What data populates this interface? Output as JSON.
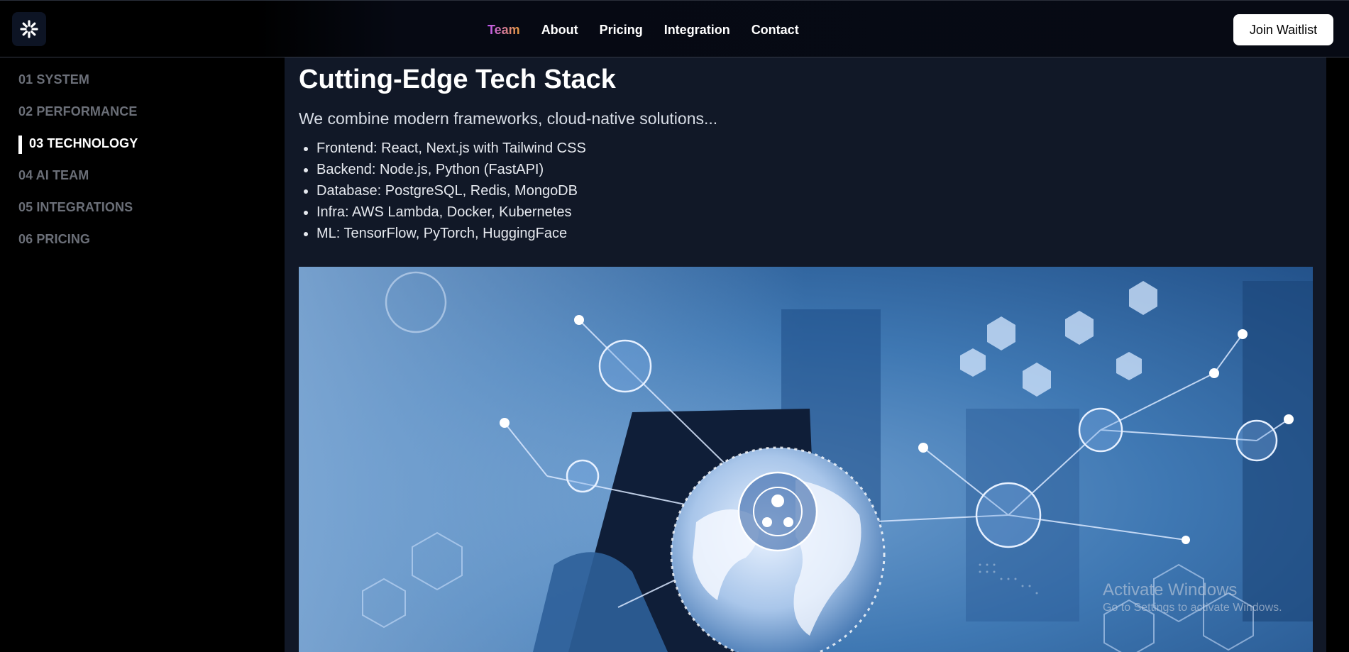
{
  "header": {
    "logo_icon": "starburst-logo-icon",
    "nav": [
      {
        "label": "Team",
        "active": true
      },
      {
        "label": "About",
        "active": false
      },
      {
        "label": "Pricing",
        "active": false
      },
      {
        "label": "Integration",
        "active": false
      },
      {
        "label": "Contact",
        "active": false
      }
    ],
    "cta_label": "Join Waitlist"
  },
  "sidebar": {
    "items": [
      {
        "label": "01 SYSTEM",
        "active": false
      },
      {
        "label": "02 PERFORMANCE",
        "active": false
      },
      {
        "label": "03 TECHNOLOGY",
        "active": true
      },
      {
        "label": "04 AI TEAM",
        "active": false
      },
      {
        "label": "05 INTEGRATIONS",
        "active": false
      },
      {
        "label": "06 PRICING",
        "active": false
      }
    ]
  },
  "main": {
    "title": "Cutting-Edge Tech Stack",
    "subtitle": "We combine modern frameworks, cloud-native solutions...",
    "stack": [
      "Frontend: React, Next.js with Tailwind CSS",
      "Backend: Node.js, Python (FastAPI)",
      "Database: PostgreSQL, Redis, MongoDB",
      "Infra: AWS Lambda, Docker, Kubernetes",
      "ML: TensorFlow, PyTorch, HuggingFace"
    ],
    "hero_image": "globe-network-technology-image"
  },
  "watermark": {
    "title": "Activate Windows",
    "subtitle": "Go to Settings to activate Windows."
  },
  "colors": {
    "main_bg": "#111827",
    "active_nav_gradient": [
      "#c058f5",
      "#e69a3a"
    ],
    "sidebar_inactive": "#6b6f78"
  }
}
